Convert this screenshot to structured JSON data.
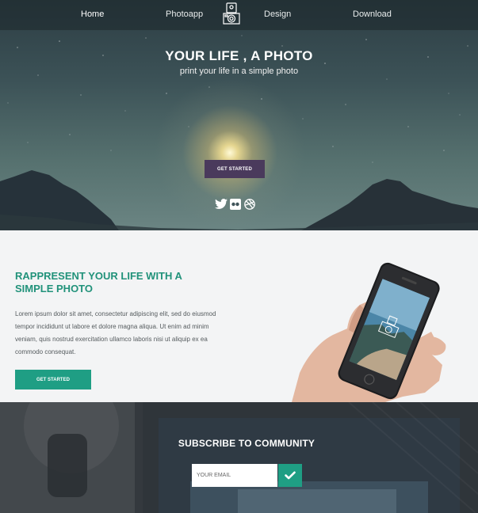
{
  "nav": {
    "items": [
      {
        "label": "Home"
      },
      {
        "label": "Photoapp"
      },
      {
        "label": "Design"
      },
      {
        "label": "Download"
      }
    ],
    "logo_icon": "camera-logo-icon"
  },
  "hero": {
    "title": "YOUR LIFE , A PHOTO",
    "subtitle": "print your life in a simple photo",
    "cta_label": "GET STARTED",
    "social": [
      "twitter-icon",
      "flickr-icon",
      "dribbble-icon"
    ]
  },
  "feature": {
    "title": "RAPPRESENT YOUR LIFE WITH A SIMPLE PHOTO",
    "body": "Lorem ipsum dolor sit amet, consectetur adipiscing elit, sed do eiusmod tempor incididunt ut labore et dolore magna aliqua. Ut enim ad minim veniam, quis nostrud exercitation ullamco laboris nisi ut aliquip ex ea commodo consequat.",
    "cta_label": "GET STARTED"
  },
  "subscribe": {
    "title": "SUBSCRIBE TO COMMUNITY",
    "input_placeholder": "YOUR EMAIL",
    "submit_icon": "check-icon"
  },
  "colors": {
    "accent": "#1f9e84",
    "title_green": "#21927a",
    "hero_button": "#4a3a5c"
  }
}
